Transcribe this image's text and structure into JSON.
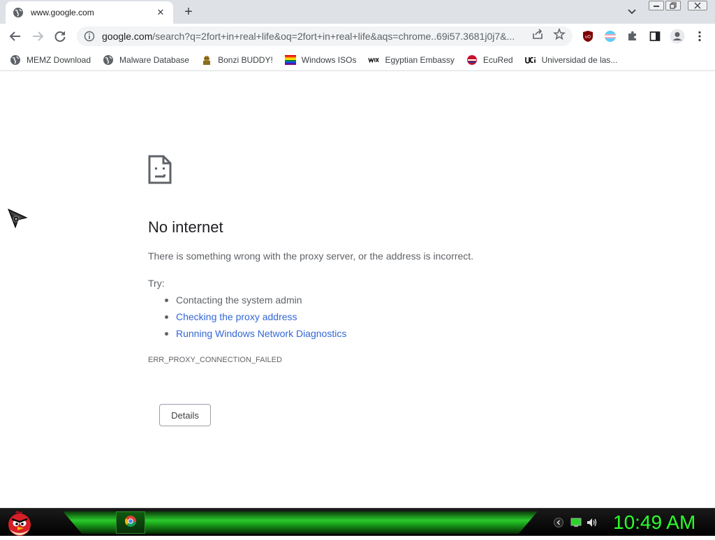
{
  "browser": {
    "tab": {
      "title": "www.google.com",
      "favicon": "globe-icon"
    },
    "omnibox": {
      "host": "google.com",
      "path": "/search?q=2fort+in+real+life&oq=2fort+in+real+life&aqs=chrome..69i57.3681j0j7&..."
    }
  },
  "bookmarks": [
    {
      "label": "MEMZ Download",
      "icon": "globe-icon"
    },
    {
      "label": "Malware Database",
      "icon": "globe-icon"
    },
    {
      "label": "Bonzi BUDDY!",
      "icon": "bonzi-icon"
    },
    {
      "label": "Windows ISOs",
      "icon": "rainbow-flag-icon"
    },
    {
      "label": "Egyptian Embassy",
      "icon": "wix-icon"
    },
    {
      "label": "EcuRed",
      "icon": "ecured-icon"
    },
    {
      "label": "Universidad de las...",
      "icon": "uci-icon"
    }
  ],
  "error_page": {
    "title": "No internet",
    "description": "There is something wrong with the proxy server, or the address is incorrect.",
    "try_label": "Try:",
    "suggestions": [
      "Contacting the system admin",
      "Checking the proxy address",
      "Running Windows Network Diagnostics"
    ],
    "error_code": "ERR_PROXY_CONNECTION_FAILED",
    "details_button": "Details"
  },
  "taskbar": {
    "clock": "10:49 AM"
  },
  "colors": {
    "link": "#3367d6",
    "clock": "#2bff2b",
    "taskbar_glow": "#2bd42b"
  }
}
